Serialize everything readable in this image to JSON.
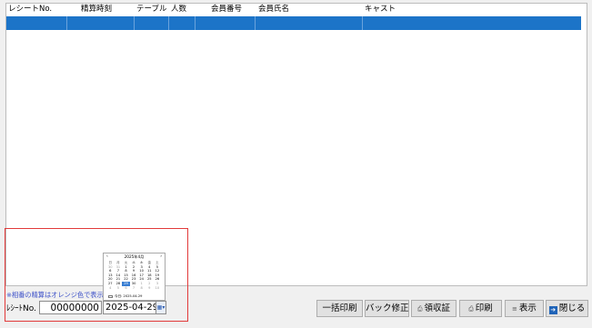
{
  "grid": {
    "columns": [
      "レシートNo.",
      "精算時刻",
      "テーブル",
      "人数",
      "会員番号",
      "会員氏名",
      "キャスト"
    ]
  },
  "calendar": {
    "title": "2025年4月",
    "prev": "‹",
    "next": "›",
    "weekdays": [
      "日",
      "月",
      "火",
      "水",
      "木",
      "金",
      "土"
    ],
    "days": [
      "30",
      "31",
      "1",
      "2",
      "3",
      "4",
      "5",
      "6",
      "7",
      "8",
      "9",
      "10",
      "11",
      "12",
      "13",
      "14",
      "15",
      "16",
      "17",
      "18",
      "19",
      "20",
      "21",
      "22",
      "23",
      "24",
      "25",
      "26",
      "27",
      "28",
      "29",
      "30",
      "1",
      "2",
      "3",
      "4",
      "5",
      "6",
      "7",
      "8",
      "9",
      "10"
    ],
    "selected_index": 30,
    "today_label": "今日: 2025-04-29"
  },
  "note": "※相番の精算はオレンジ色で表示",
  "filter": {
    "receipt_label": "ﾚｼｰﾄNo.",
    "receipt_value": "00000000",
    "date_value": "2025-04-29",
    "dropdown_icon": "calendar-dropdown-icon"
  },
  "buttons": {
    "bulk_print": "一括印刷",
    "back_edit": "バック修正",
    "receipt_print": "領収証",
    "print": "印刷",
    "display": "表示",
    "close": "閉じる"
  },
  "colors": {
    "selection": "#1c74c8",
    "annotation": "#e23a3a",
    "note_text": "#3c50c8"
  }
}
